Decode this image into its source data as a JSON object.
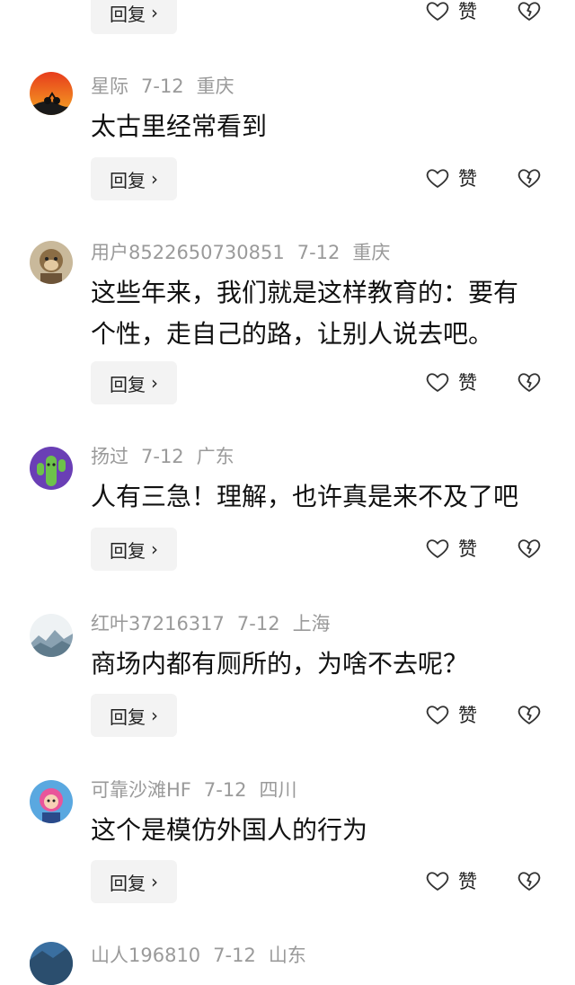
{
  "actions": {
    "reply_label": "回复",
    "reply_chevron": "›",
    "like_label": "赞"
  },
  "comments": [
    {
      "user": "",
      "date": "",
      "location": "",
      "text": "",
      "avatar": "none"
    },
    {
      "user": "星际",
      "date": "7-12",
      "location": "重庆",
      "text": "太古里经常看到",
      "avatar": "sunset-rider"
    },
    {
      "user": "用户8522650730851",
      "date": "7-12",
      "location": "重庆",
      "text": "这些年来，我们就是这样教育的：要有个性，走自己的路，让别人说去吧。",
      "avatar": "monkey"
    },
    {
      "user": "扬过",
      "date": "7-12",
      "location": "广东",
      "text": "人有三急！理解，也许真是来不及了吧",
      "avatar": "cactus"
    },
    {
      "user": "红叶37216317",
      "date": "7-12",
      "location": "上海",
      "text": "商场内都有厕所的，为啥不去呢？",
      "avatar": "misty-mountains"
    },
    {
      "user": "可靠沙滩HF",
      "date": "7-12",
      "location": "四川",
      "text": "这个是模仿外国人的行为",
      "avatar": "cartoon-girl"
    },
    {
      "user": "山人196810",
      "date": "7-12",
      "location": "山东",
      "text": "",
      "avatar": "landscape"
    }
  ],
  "icons": {
    "like": "heart-outline-icon",
    "dislike": "broken-heart-icon",
    "reply_arrow": "chevron-right-icon"
  }
}
